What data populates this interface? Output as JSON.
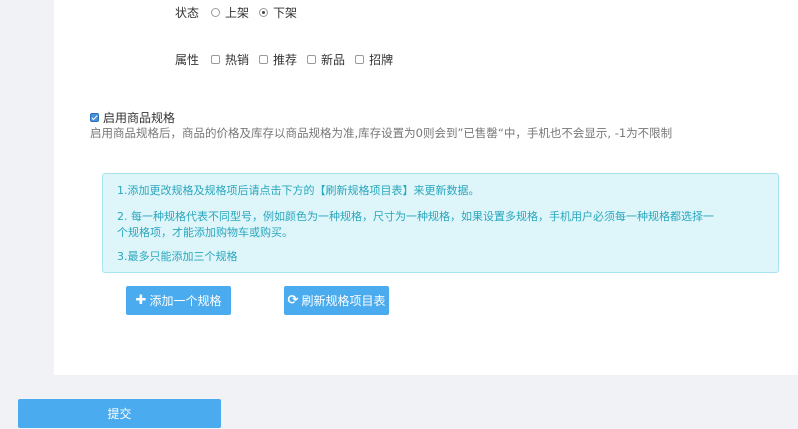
{
  "status": {
    "label": "状态",
    "options": [
      {
        "label": "上架",
        "checked": false
      },
      {
        "label": "下架",
        "checked": true
      }
    ]
  },
  "attributes": {
    "label": "属性",
    "options": [
      {
        "label": "热销",
        "checked": false
      },
      {
        "label": "推荐",
        "checked": false
      },
      {
        "label": "新品",
        "checked": false
      },
      {
        "label": "招牌",
        "checked": false
      }
    ]
  },
  "spec": {
    "enable_label": "启用商品规格",
    "enabled": true,
    "help": "启用商品规格后，商品的价格及库存以商品规格为准,库存设置为0则会到”已售罄“中，手机也不会显示, -1为不限制"
  },
  "alert": {
    "line1": "1.添加更改规格及规格项后请点击下方的【刷新规格项目表】来更新数据。",
    "line2a": "2. 每一种规格代表不同型号，例如颜色为一种规格，尺寸为一种规格，如果设置多规格，手机用户必须每一种规格都选择一",
    "line2b": "个规格项，才能添加购物车或购买。",
    "line3": "3.最多只能添加三个规格",
    "color": "#2aa6bd"
  },
  "buttons": {
    "add_spec": "添加一个规格",
    "refresh": "刷新规格项目表",
    "submit": "提交",
    "color": "#4aabef"
  }
}
